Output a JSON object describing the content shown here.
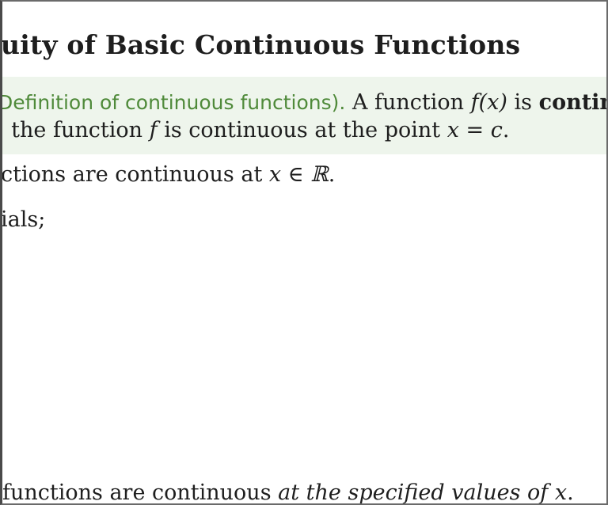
{
  "title": "uity of Basic Continuous Functions",
  "definition": {
    "heading": "Definition of continuous functions)",
    "heading_punct": ".",
    "line1_text": "A function",
    "line1_fx": "f(x)",
    "line1_is": "is",
    "line1_bold": "continuo",
    "line2_prefix": ", the function",
    "line2_f": "f",
    "line2_mid": "is continuous at the point",
    "line2_eq": "x = c",
    "line2_end": "."
  },
  "line3": {
    "text": "ctions are continuous at",
    "math": "x ∈ ℝ",
    "end": "."
  },
  "line4": {
    "text": "ials;"
  },
  "line5": {
    "text": "functions are continuous",
    "italic": "at the specified values of",
    "math": "x",
    "end": "."
  }
}
